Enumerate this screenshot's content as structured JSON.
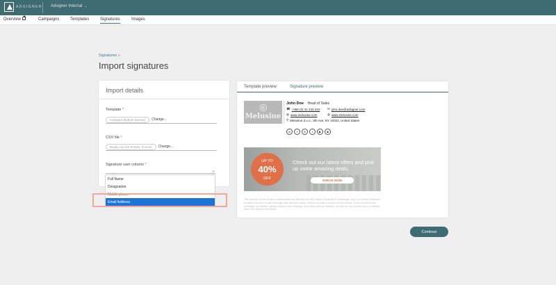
{
  "topbar": {
    "logo_text": "ADSIGNER",
    "workspace": "Adsigner Internal",
    "workspace_caret": "⌄"
  },
  "nav": {
    "items": [
      {
        "label": "Overview"
      },
      {
        "label": "Campaigns"
      },
      {
        "label": "Templates"
      },
      {
        "label": "Signatures"
      },
      {
        "label": "Images"
      }
    ],
    "active": "Signatures"
  },
  "breadcrumb": "Signatures »",
  "page_title": "Import signatures",
  "import_details": {
    "title": "Import details",
    "template": {
      "label": "Template",
      "required_mark": "*",
      "file": "Compact (bottom banner)",
      "change": "Change..."
    },
    "csv": {
      "label": "CSV file",
      "required_mark": "*",
      "file": "Book1.csv (10 entries, 0 error)",
      "change": "Change..."
    },
    "column": {
      "label": "Signature user column",
      "required_mark": "*",
      "caret": "▼",
      "options": [
        "Full Name",
        "Designation",
        "Mobile phone",
        "Email Address"
      ],
      "selected": "Email Address"
    }
  },
  "preview": {
    "tabs": [
      "Template preview",
      "Signature preview"
    ],
    "active_tab": "Template preview",
    "signature": {
      "logo_text": "Melusine",
      "name": "John Doe",
      "role": "Head of Sales",
      "phone": "+386 (0) 31 233 334",
      "email": "john.doe@adsigner.com",
      "website1": "www.melusine.com",
      "website2": "www.melusine.com",
      "address": "Melusine d.o.o., 5th Ave, NY 10022, United States",
      "social": [
        "in",
        "f",
        "◎",
        "t",
        "▶",
        "◙"
      ]
    },
    "banner": {
      "badge_up": "UP TO",
      "badge_pct": "40%",
      "badge_off": "OFF",
      "text": "Check out our latest offers and pick up some amazing deals.",
      "cta": "CHECK NOW"
    },
    "disclaimer": "The content of this email is confidential and intended for the recipient specified in message only. It is strictly forbidden to share any part of this message with any third party, without a written consent of the sender. If you received this message by mistake, please reply to this message and follow with its deletion, so that we can ensure such a mistake does not occur in the future."
  },
  "continue_label": "Continue",
  "colors": {
    "brand": "#3f6b72",
    "accent_orange": "#e07048",
    "selection_blue": "#1e74d6",
    "highlight": "#f0a89c"
  }
}
